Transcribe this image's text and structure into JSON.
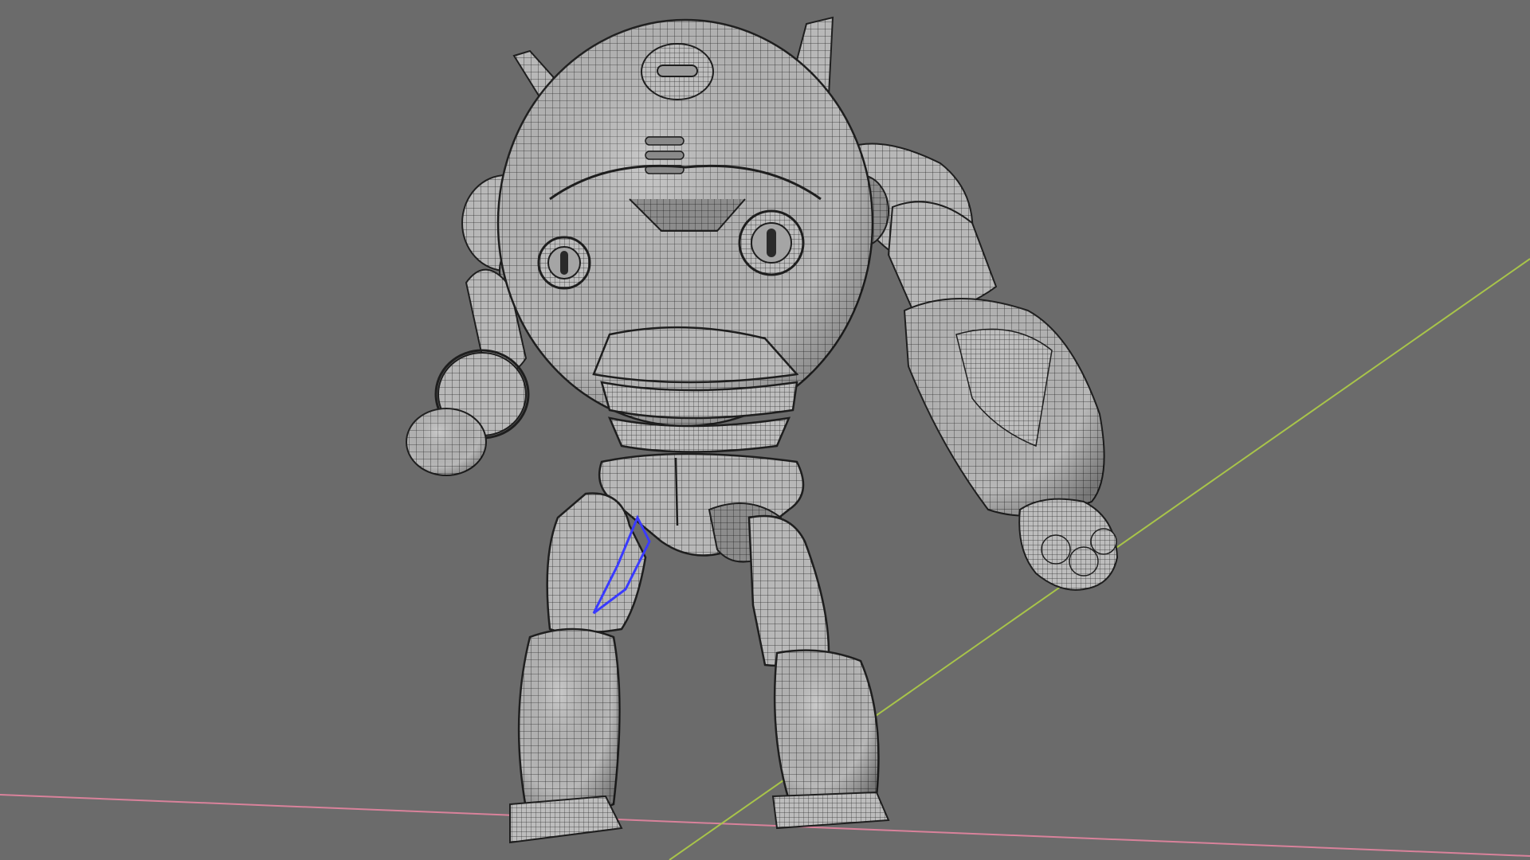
{
  "viewport": {
    "background_color": "#6b6b6b",
    "x_axis_color": "#d9829b",
    "y_axis_color": "#a8c44a",
    "selection_color": "#3a3aff"
  },
  "scene": {
    "object": "robot-model",
    "display_mode": "wireframe-on-shaded",
    "mesh_color": "#b4b4b4",
    "wire_color": "#2a2a2a"
  }
}
